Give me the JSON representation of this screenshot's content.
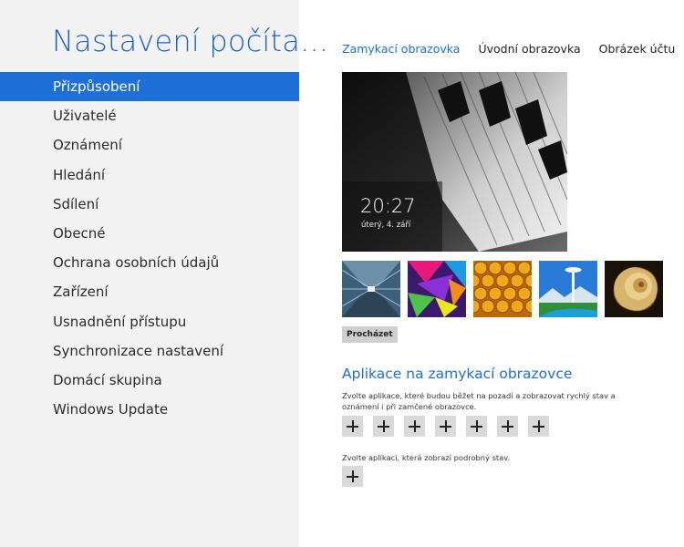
{
  "app": {
    "title": "Nastavení počíta..."
  },
  "nav": {
    "items": [
      "Přizpůsobení",
      "Uživatelé",
      "Oznámení",
      "Hledání",
      "Sdílení",
      "Obecné",
      "Ochrana osobních údajů",
      "Zařízení",
      "Usnadnění přístupu",
      "Synchronizace nastavení",
      "Domácí skupina",
      "Windows Update"
    ],
    "selected_index": 0
  },
  "tabs": {
    "lock_screen": "Zamykací obrazovka",
    "start_screen": "Úvodní obrazovka",
    "account_picture": "Obrázek účtu",
    "active": "lock_screen"
  },
  "preview": {
    "time": "20:27",
    "date": "úterý, 4. září"
  },
  "thumbnails": [
    "tunnel",
    "colorful-shapes",
    "honeycomb",
    "space-needle",
    "nautilus-shell"
  ],
  "browse_label": "Procházet",
  "lock_apps": {
    "title": "Aplikace na zamykací obrazovce",
    "quick_status_desc": "Zvolte aplikace, které budou běžet na pozadí a zobrazovat rychlý stav a oznámení i při zamčené obrazovce.",
    "quick_slots": 7,
    "detailed_status_desc": "Zvolte aplikaci, která zobrazí podrobný stav."
  },
  "colors": {
    "accent": "#1f6fd8",
    "title": "#1f63c7",
    "left_panel": "#f2f2f2"
  }
}
